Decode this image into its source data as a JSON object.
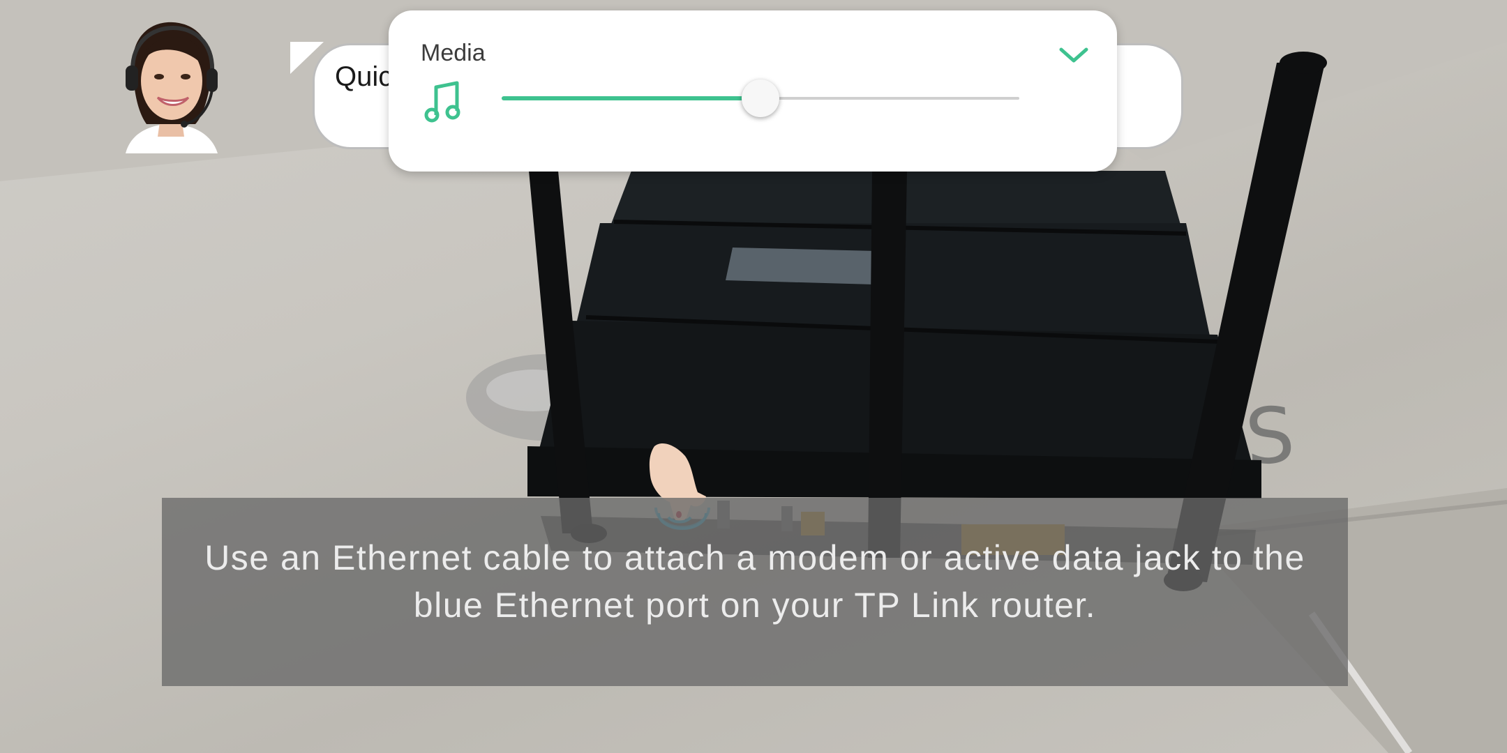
{
  "speech_bubble": {
    "text": "Quic"
  },
  "volume_panel": {
    "title": "Media",
    "stream_icon": "music-note-icon",
    "collapse_icon": "chevron-down-icon",
    "level_fraction": 0.5,
    "accent_color": "#3ec28f"
  },
  "caption": {
    "text": "Use an Ethernet cable to attach a modem or active data jack to the blue Ethernet port on your TP Link router."
  },
  "scene": {
    "background_label": "S"
  },
  "colors": {
    "panel_bg": "#ffffff",
    "track": "#cfcfcf",
    "caption_bg": "#696969",
    "caption_text": "#ececec"
  }
}
